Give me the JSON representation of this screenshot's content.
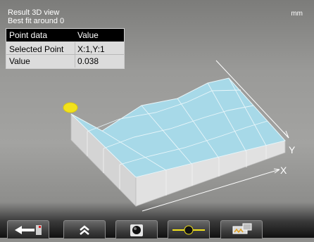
{
  "header": {
    "title": "Result 3D view",
    "subtitle": "Best fit around 0",
    "unit": "mm"
  },
  "point_table": {
    "headers": [
      "Point data",
      "Value"
    ],
    "rows": [
      {
        "label": "Selected Point",
        "value": "X:1,Y:1"
      },
      {
        "label": "Value",
        "value": "0.038"
      }
    ]
  },
  "plot": {
    "axis_x_label": "X",
    "axis_y_label": "Y",
    "surface_color": "#a7d9e8",
    "marker_color": "#f2e21c"
  },
  "toolbar": {
    "buttons": [
      {
        "icon": "back-arrow-icon"
      },
      {
        "icon": "double-chevron-up-icon"
      },
      {
        "icon": "circle-target-icon"
      },
      {
        "icon": "laser-line-icon"
      },
      {
        "icon": "machine-view-icon"
      }
    ]
  }
}
